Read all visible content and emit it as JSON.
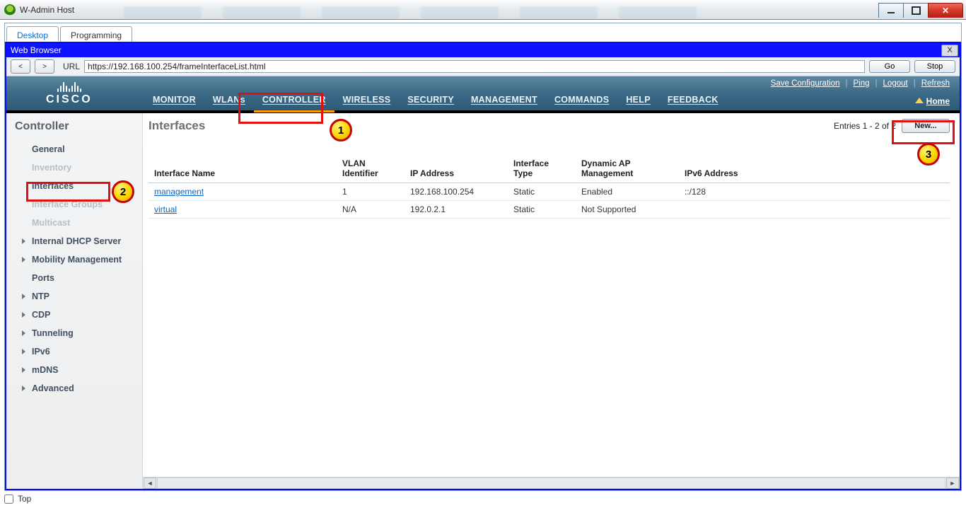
{
  "window": {
    "title": "W-Admin Host"
  },
  "app_tabs": {
    "desktop": "Desktop",
    "programming": "Programming"
  },
  "browser": {
    "title": "Web Browser",
    "url_label": "URL",
    "url": "https://192.168.100.254/frameInterfaceList.html",
    "go": "Go",
    "stop": "Stop",
    "close": "X",
    "back": "<",
    "fwd": ">"
  },
  "cisco": {
    "brand": "CISCO",
    "nav": {
      "monitor": "MONITOR",
      "wlans": "WLANs",
      "controller": "CONTROLLER",
      "wireless": "WIRELESS",
      "security": "SECURITY",
      "management": "MANAGEMENT",
      "commands": "COMMANDS",
      "help": "HELP",
      "feedback": "FEEDBACK"
    },
    "util": {
      "save": "Save Configuration",
      "ping": "Ping",
      "logout": "Logout",
      "refresh": "Refresh"
    },
    "home": "Home"
  },
  "sidebar": {
    "title": "Controller",
    "items": {
      "general": "General",
      "inventory": "Inventory",
      "interfaces": "Interfaces",
      "interface_groups": "Interface Groups",
      "multicast": "Multicast",
      "internal_dhcp": "Internal DHCP Server",
      "mobility": "Mobility Management",
      "ports": "Ports",
      "ntp": "NTP",
      "cdp": "CDP",
      "tunneling": "Tunneling",
      "ipv6": "IPv6",
      "mdns": "mDNS",
      "advanced": "Advanced"
    }
  },
  "page": {
    "title": "Interfaces",
    "entries": "Entries 1 - 2 of 2",
    "new_btn": "New...",
    "headers": {
      "name": "Interface Name",
      "vlan": "VLAN Identifier",
      "ip": "IP Address",
      "type": "Interface Type",
      "dyn": "Dynamic AP Management",
      "ipv6": "IPv6 Address"
    },
    "rows": [
      {
        "name": "management",
        "vlan": "1",
        "ip": "192.168.100.254",
        "type": "Static",
        "dyn": "Enabled",
        "ipv6": "::/128"
      },
      {
        "name": "virtual",
        "vlan": "N/A",
        "ip": "192.0.2.1",
        "type": "Static",
        "dyn": "Not Supported",
        "ipv6": ""
      }
    ]
  },
  "annotations": {
    "n1": "1",
    "n2": "2",
    "n3": "3"
  },
  "footer": {
    "top": "Top"
  }
}
